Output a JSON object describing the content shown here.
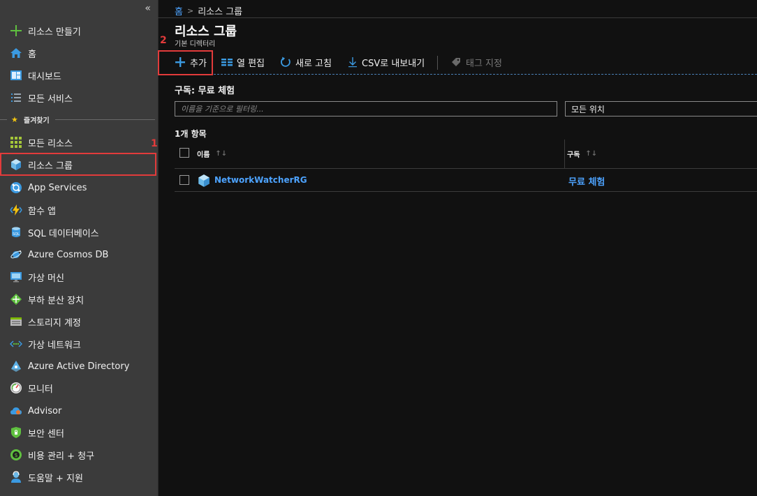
{
  "sidebar": {
    "collapse_glyph": "«",
    "favorites_label": "즐겨찾기",
    "items": [
      {
        "label": "리소스 만들기",
        "icon": "plus-icon"
      },
      {
        "label": "홈",
        "icon": "home-icon"
      },
      {
        "label": "대시보드",
        "icon": "dashboard-icon"
      },
      {
        "label": "모든 서비스",
        "icon": "list-icon"
      },
      {
        "label": "모든 리소스",
        "icon": "grid-icon"
      },
      {
        "label": "리소스 그룹",
        "icon": "resource-group-icon"
      },
      {
        "label": "App Services",
        "icon": "app-services-icon"
      },
      {
        "label": "함수 앱",
        "icon": "function-icon"
      },
      {
        "label": "SQL 데이터베이스",
        "icon": "sql-database-icon"
      },
      {
        "label": "Azure Cosmos DB",
        "icon": "cosmos-db-icon"
      },
      {
        "label": "가상 머신",
        "icon": "virtual-machine-icon"
      },
      {
        "label": "부하 분산 장치",
        "icon": "load-balancer-icon"
      },
      {
        "label": "스토리지 계정",
        "icon": "storage-icon"
      },
      {
        "label": "가상 네트워크",
        "icon": "virtual-network-icon"
      },
      {
        "label": "Azure Active Directory",
        "icon": "active-directory-icon"
      },
      {
        "label": "모니터",
        "icon": "monitor-icon"
      },
      {
        "label": "Advisor",
        "icon": "advisor-icon"
      },
      {
        "label": "보안 센터",
        "icon": "shield-icon"
      },
      {
        "label": "비용 관리 + 청구",
        "icon": "cost-icon"
      },
      {
        "label": "도움말 + 지원",
        "icon": "help-icon"
      }
    ]
  },
  "annotations": {
    "one": "1",
    "two": "2"
  },
  "breadcrumb": {
    "home": "홈",
    "separator": ">",
    "current": "리소스 그룹"
  },
  "page": {
    "title": "리소스 그룹",
    "subtitle": "기본 디렉터리"
  },
  "toolbar": {
    "add": "추가",
    "edit_columns": "열 편집",
    "refresh": "새로 고침",
    "export_csv": "CSV로 내보내기",
    "assign_tags": "태그 지정"
  },
  "subscription_label": "구독: 무료 체험",
  "filter": {
    "placeholder": "이름을 기준으로 필터링..."
  },
  "location_filter": "모든 위치",
  "item_count": "1개 항목",
  "table": {
    "headers": {
      "name": "이름",
      "subscription": "구독",
      "sort_glyph": "↑↓"
    },
    "rows": [
      {
        "name": "NetworkWatcherRG",
        "subscription": "무료 체험"
      }
    ]
  }
}
